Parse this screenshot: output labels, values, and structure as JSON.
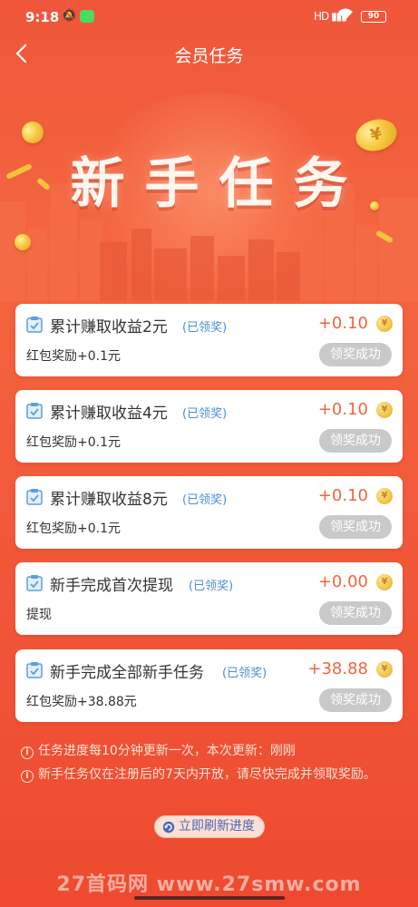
{
  "status_bar": {
    "time": "9:18",
    "signal": "HD",
    "battery": "90"
  },
  "header": {
    "title": "会员任务"
  },
  "banner": {
    "title": "新手任务"
  },
  "tasks": [
    {
      "title": "累计赚取收益2元",
      "tag": "(已领奖)",
      "reward": "+0.10",
      "desc": "红包奖励+0.1元",
      "button": "领奖成功"
    },
    {
      "title": "累计赚取收益4元",
      "tag": "(已领奖)",
      "reward": "+0.10",
      "desc": "红包奖励+0.1元",
      "button": "领奖成功"
    },
    {
      "title": "累计赚取收益8元",
      "tag": "(已领奖)",
      "reward": "+0.10",
      "desc": "红包奖励+0.1元",
      "button": "领奖成功"
    },
    {
      "title": "新手完成首次提现",
      "tag": "(已领奖)",
      "reward": "+0.00",
      "desc": "提现",
      "button": "领奖成功"
    },
    {
      "title": "新手完成全部新手任务",
      "tag": "(已领奖)",
      "reward": "+38.88",
      "desc": "红包奖励+38.88元",
      "button": "领奖成功"
    }
  ],
  "coin_symbol": "¥",
  "notes": [
    "任务进度每10分钟更新一次，本次更新：刚刚",
    "新手任务仅在注册后的7天内开放，请尽快完成并领取奖励。"
  ],
  "refresh_button": "立即刷新进度",
  "watermark": "27首码网 www.27smw.com",
  "colors": {
    "background": "#f24a2c",
    "reward_text": "#f0663d",
    "tag_text": "#4a8fd6",
    "button_done": "#c9c9c9"
  }
}
